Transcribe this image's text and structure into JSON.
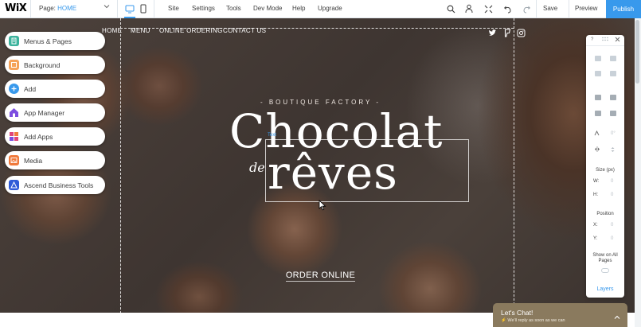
{
  "topbar": {
    "logo": "WiX",
    "page_prefix": "Page:",
    "page_value": "HOME",
    "menu": [
      "Site",
      "Settings",
      "Tools",
      "Dev Mode",
      "Help",
      "Upgrade"
    ],
    "save_label": "Save",
    "preview_label": "Preview",
    "publish_label": "Publish"
  },
  "site": {
    "nav": [
      "HOME",
      "MENU",
      "ONLINE ORDERING",
      "CONTACT US"
    ],
    "tagline": "- BOUTIQUE FACTORY -",
    "title_line1": "Chocolat",
    "title_de": "de",
    "title_line2": "rêves",
    "selection_tag": "Text",
    "order_cta": "ORDER ONLINE"
  },
  "left_panel": {
    "items": [
      {
        "label": "Menus & Pages",
        "icon": "pages-icon",
        "color": "#3cb39d"
      },
      {
        "label": "Background",
        "icon": "background-icon",
        "color": "#f5a35a"
      },
      {
        "label": "Add",
        "icon": "plus-icon",
        "color": "#3899ec"
      },
      {
        "label": "App Manager",
        "icon": "app-manager-icon",
        "color": "#7c4ee0"
      },
      {
        "label": "Add Apps",
        "icon": "apps-icon",
        "color": "#e0457b"
      },
      {
        "label": "Media",
        "icon": "media-icon",
        "color": "#f07a3c"
      },
      {
        "label": "Ascend Business Tools",
        "icon": "ascend-icon",
        "color": "#2f5bd8"
      }
    ]
  },
  "inspector": {
    "help": "?",
    "size_label": "Size (px)",
    "w_label": "W:",
    "h_label": "H:",
    "w_value": "0",
    "h_value": "0",
    "position_label": "Position",
    "x_label": "X:",
    "y_label": "Y:",
    "x_value": "0",
    "y_value": "0",
    "rotation_value": "0°",
    "show_all_label": "Show on All Pages",
    "layers_label": "Layers"
  },
  "chat": {
    "title": "Let's Chat!",
    "subtitle": "We'll reply as soon as we can"
  }
}
